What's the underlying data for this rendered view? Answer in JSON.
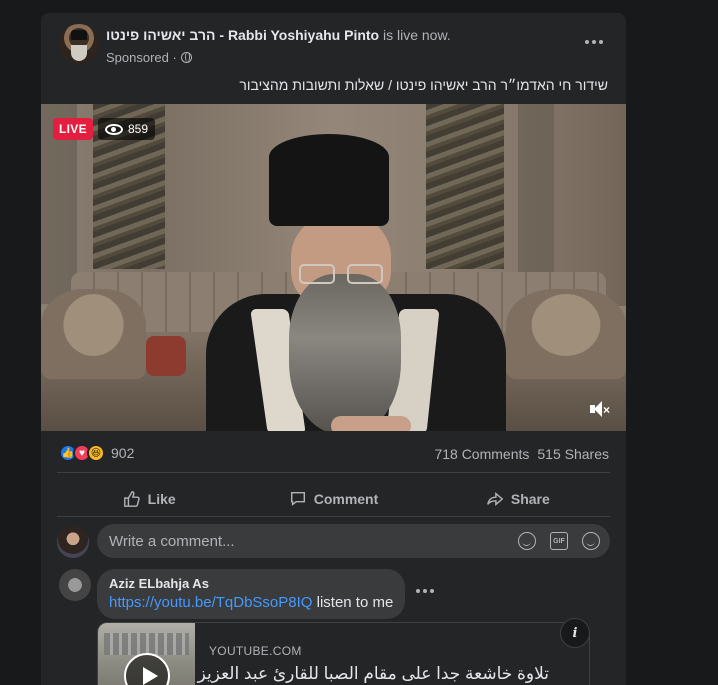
{
  "post": {
    "author": "הרב יאשיהו פינטו - Rabbi Yoshiyahu Pinto",
    "status": " is live now.",
    "sponsored": "Sponsored ·",
    "text": "שידור חי האדמו״ר הרב יאשיהו פינטו / שאלות ותשובות מהציבור"
  },
  "video": {
    "live_label": "LIVE",
    "viewers": "859"
  },
  "stats": {
    "reaction_count": "902",
    "comments": "718 Comments",
    "shares": "515 Shares"
  },
  "actions": {
    "like": "Like",
    "comment": "Comment",
    "share": "Share"
  },
  "composer": {
    "placeholder": "Write a comment...",
    "gif_label": "GIF"
  },
  "reply": {
    "author": "Aziz ELbahja As",
    "link": "https://youtu.be/TqDbSsoP8IQ",
    "text": " listen to me"
  },
  "preview": {
    "domain": "YOUTUBE.COM",
    "title": "تلاوة خاشعة جدا على مقام الصبا للقارئ عبد العزيز",
    "info": "i"
  },
  "colors": {
    "background": "#18191a",
    "card": "#242526",
    "live": "#e41e3f",
    "link": "#4599ff"
  }
}
